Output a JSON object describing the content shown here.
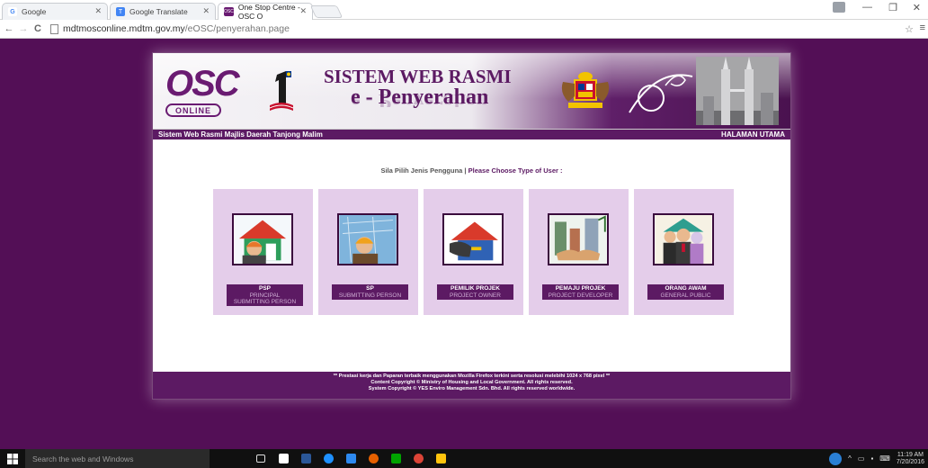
{
  "browser": {
    "tabs": [
      {
        "title": "Google",
        "favicon": "G",
        "favicon_color": "#4285f4"
      },
      {
        "title": "Google Translate",
        "favicon": "T",
        "favicon_color": "#4285f4"
      },
      {
        "title": "One Stop Centre - OSC O",
        "favicon": "OSC",
        "favicon_color": "#6a1b72"
      }
    ],
    "url_host": "mdtmosconline.mdtm.gov.my",
    "url_path": "/eOSC/penyerahan.page"
  },
  "header": {
    "logo_osc": "OSC",
    "logo_online": "ONLINE",
    "logo_one": "1",
    "title_main": "SISTEM WEB RASMI",
    "title_sub": "e - Penyerahan",
    "subbar_left": "Sistem Web Rasmi Majlis Daerah Tanjong Malim",
    "subbar_right": "HALAMAN UTAMA"
  },
  "content": {
    "prompt_ms": "Sila Pilih Jenis Pengguna |",
    "prompt_en": "Please Choose Type of User :",
    "cards": [
      {
        "line1": "PSP",
        "line2": "PRINCIPAL",
        "line3": "SUBMITTING PERSON",
        "icon": "engineer-house-icon"
      },
      {
        "line1": "SP",
        "line2": "SUBMITTING PERSON",
        "line3": "",
        "icon": "engineer-blueprint-icon"
      },
      {
        "line1": "PEMILIK PROJEK",
        "line2": "PROJECT OWNER",
        "line3": "",
        "icon": "house-key-icon"
      },
      {
        "line1": "PEMAJU PROJEK",
        "line2": "PROJECT DEVELOPER",
        "line3": "",
        "icon": "handshake-buildings-icon"
      },
      {
        "line1": "ORANG AWAM",
        "line2": "GENERAL PUBLIC",
        "line3": "",
        "icon": "public-people-icon"
      }
    ]
  },
  "footer": {
    "line1": "** Prestasi kerja dan Paparan terbaik menggunakan Mozilla Firefox terkini serta resolusi melebihi 1024 x 768 pixel **",
    "line2": "Content Copyright © Ministry of Housing and Local Government. All rights reserved.",
    "line3": "System Copyright © YES Enviro Management Sdn. Bhd. All rights reserved worldwide."
  },
  "taskbar": {
    "search_placeholder": "Search the web and Windows",
    "time": "11:19 AM",
    "date": "7/20/2016"
  },
  "colors": {
    "page_bg": "#530f56",
    "brand_purple": "#5c1a63",
    "card_bg": "#e4cdea"
  }
}
